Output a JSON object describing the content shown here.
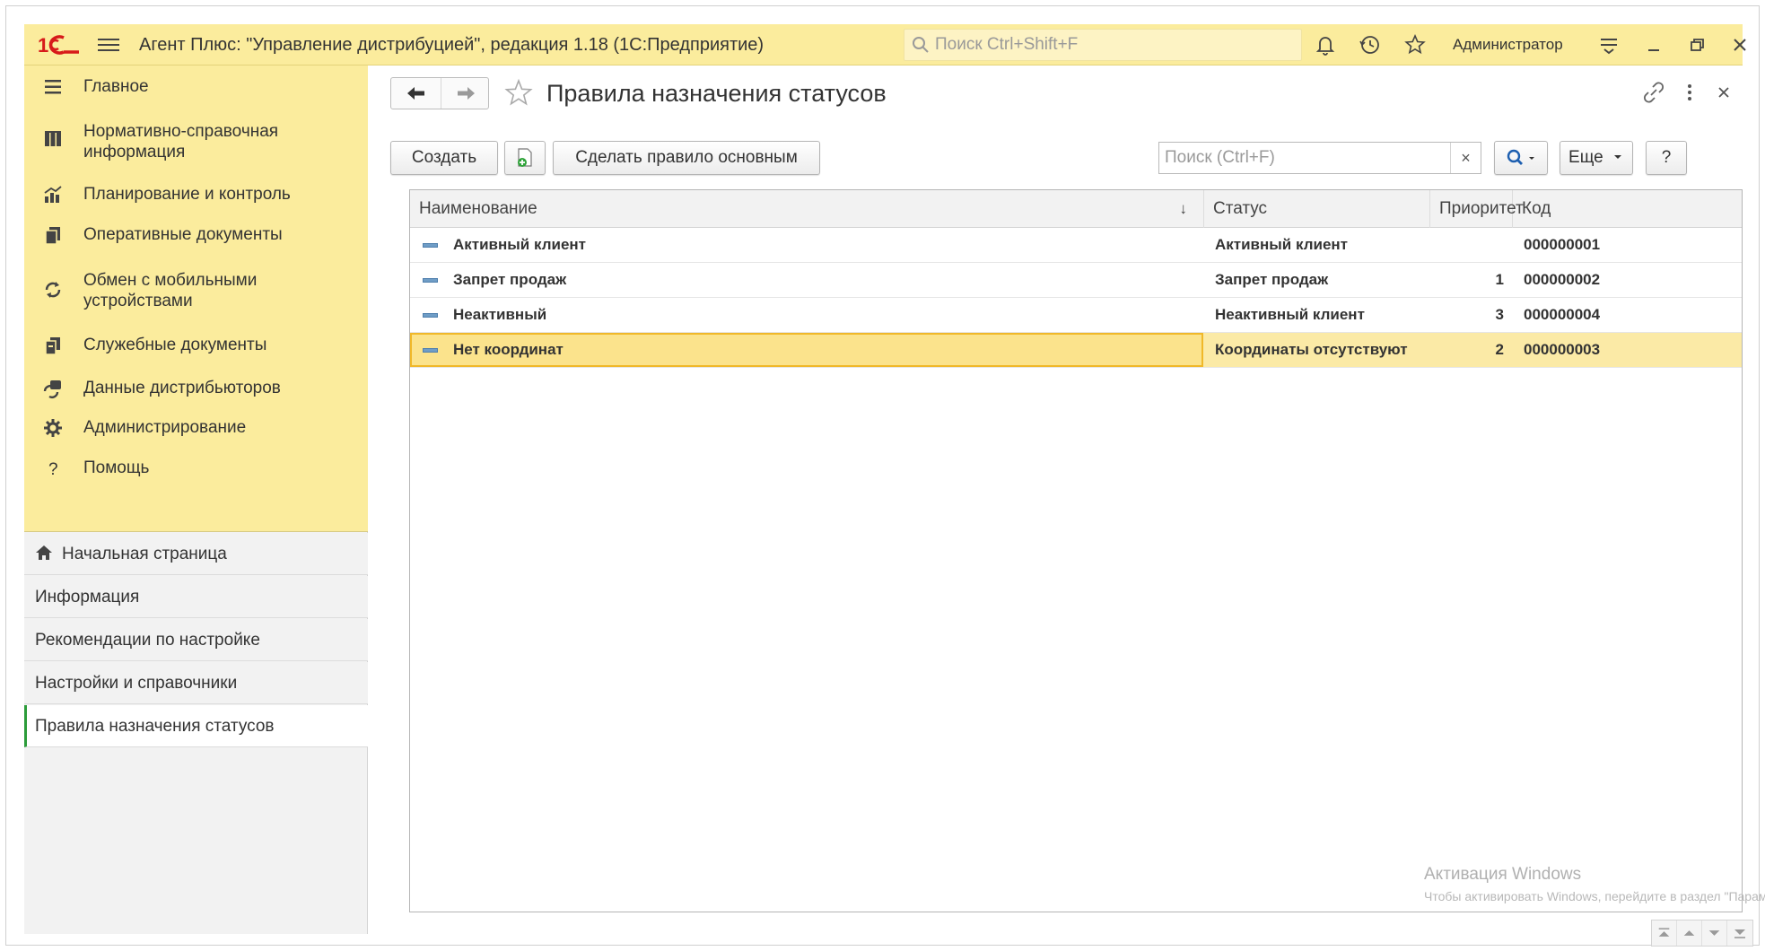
{
  "titlebar": {
    "title": "Агент Плюс: \"Управление дистрибуцией\", редакция 1.18  (1С:Предприятие)",
    "search_placeholder": "Поиск Ctrl+Shift+F",
    "user": "Администратор",
    "logo_text": "1С"
  },
  "sidebar": {
    "sections": [
      {
        "label": "Главное",
        "icon": "menu-lines-icon"
      },
      {
        "label": "Нормативно-справочная информация",
        "icon": "catalog-icon"
      },
      {
        "label": "Планирование и контроль",
        "icon": "chart-icon"
      },
      {
        "label": "Оперативные документы",
        "icon": "documents-icon"
      },
      {
        "label": "Обмен с мобильными устройствами",
        "icon": "sync-icon"
      },
      {
        "label": "Служебные документы",
        "icon": "service-docs-icon"
      },
      {
        "label": "Данные дистрибьюторов",
        "icon": "distributors-icon"
      },
      {
        "label": "Администрирование",
        "icon": "gear-icon"
      },
      {
        "label": "Помощь",
        "icon": "help-icon"
      }
    ],
    "open_windows": [
      {
        "label": "Начальная страница"
      },
      {
        "label": "Информация"
      },
      {
        "label": "Рекомендации по настройке"
      },
      {
        "label": "Настройки и справочники"
      },
      {
        "label": "Правила назначения статусов"
      }
    ]
  },
  "form": {
    "title": "Правила назначения статусов",
    "create_label": "Создать",
    "make_main_label": "Сделать правило основным",
    "search_placeholder": "Поиск (Ctrl+F)",
    "clear_label": "×",
    "more_label": "Еще",
    "help_label": "?"
  },
  "table": {
    "columns": {
      "name": "Наименование",
      "status": "Статус",
      "priority": "Приоритет",
      "code": "Код",
      "sort_indicator": "↓"
    },
    "rows": [
      {
        "name": "Активный клиент",
        "status": "Активный клиент",
        "priority": "",
        "code": "000000001"
      },
      {
        "name": "Запрет продаж",
        "status": "Запрет продаж",
        "priority": "1",
        "code": "000000002"
      },
      {
        "name": "Неактивный",
        "status": "Неактивный клиент",
        "priority": "3",
        "code": "000000004"
      },
      {
        "name": "Нет координат",
        "status": "Координаты отсутствуют",
        "priority": "2",
        "code": "000000003"
      }
    ],
    "selected_row_index": 3
  },
  "watermark": {
    "line1": "Активация Windows",
    "line2": "Чтобы активировать Windows, перейдите в раздел \"Параметры\"."
  },
  "colors": {
    "titlebar_bg": "#fbec9d",
    "sections_bg": "#fbec9d",
    "selected_row": "#fbeaa6",
    "active_marker": "#2c9c3a"
  }
}
